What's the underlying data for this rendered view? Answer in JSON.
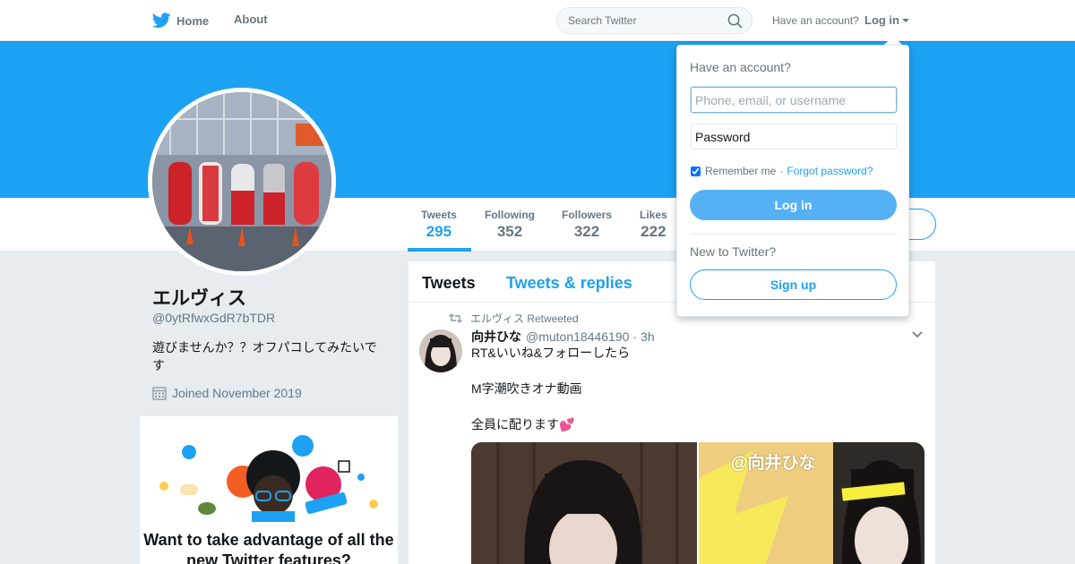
{
  "nav": {
    "home_label": "Home",
    "about_label": "About",
    "search_placeholder": "Search Twitter",
    "have_account": "Have an account?",
    "login_label": "Log in",
    "brand_color": "#1da1f2",
    "icons": {
      "logo": "twitter-bird-icon",
      "search": "search-icon",
      "caret": "caret-down-icon"
    }
  },
  "profile": {
    "name": "エルヴィス",
    "handle": "@0ytRfwxGdR7bTDR",
    "bio": "遊びませんか？？オフパコしてみたいです",
    "joined": "Joined November 2019",
    "stats": [
      {
        "label": "Tweets",
        "value": "295",
        "active": true
      },
      {
        "label": "Following",
        "value": "352",
        "active": false
      },
      {
        "label": "Followers",
        "value": "322",
        "active": false
      },
      {
        "label": "Likes",
        "value": "222",
        "active": false
      }
    ]
  },
  "promo": {
    "title": "Want to take advantage of all the new Twitter features?"
  },
  "timeline": {
    "tabs": [
      "Tweets",
      "Tweets & replies"
    ],
    "tweet": {
      "retweeted_by": "エルヴィス Retweeted",
      "author": "向井ひな",
      "handle": "@muton18446190",
      "separator": "·",
      "time": "3h",
      "lines": [
        "RT&いいね&フォローしたら",
        "",
        "M字潮吹きオナ動画",
        "",
        "全員に配ります💕"
      ],
      "media_caption": "@向井ひな"
    }
  },
  "login_dropdown": {
    "title": "Have an account?",
    "phone_placeholder": "Phone, email, or username",
    "password_placeholder": "Password",
    "remember_label": "Remember me",
    "separator": "·",
    "forgot_label": "Forgot password?",
    "login_button": "Log in",
    "new_label": "New to Twitter?",
    "signup_button": "Sign up",
    "remember_checked": true
  }
}
